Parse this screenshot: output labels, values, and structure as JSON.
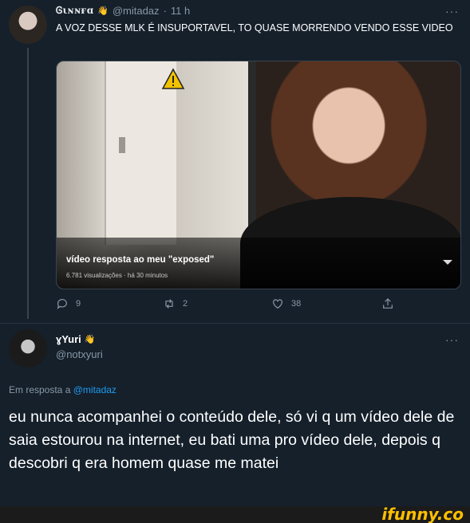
{
  "tweet1": {
    "display_name": "Ꮆιɴɴғɑ",
    "handle": "@mitadaz",
    "separator": "·",
    "time": "11 h",
    "more_icon": "more-horizontal-icon",
    "text": "A VOZ DESSE MLK É INSUPORTAVEL, TO QUASE MORRENDO VENDO ESSE VIDEO",
    "media": {
      "title": "vídeo resposta ao meu \"exposed\"",
      "meta": "6.781 visualizações · há 30 minutos"
    },
    "actions": {
      "reply_count": "9",
      "retweet_count": "2",
      "like_count": "38"
    }
  },
  "tweet2": {
    "display_name": "ɣYuri",
    "handle": "@notxyuri",
    "reply_prefix": "Em resposta a",
    "reply_to": "@mitadaz",
    "text": "eu nunca acompanhei o conteúdo dele, só vi q um vídeo dele de saia estourou na internet, eu bati uma pro vídeo dele, depois q descobri q era homem quase me matei"
  },
  "watermark": "ifunny.co",
  "colors": {
    "background": "#15202b",
    "muted": "#8899a6",
    "link": "#1d9bf0",
    "watermark": "#ffc000"
  }
}
